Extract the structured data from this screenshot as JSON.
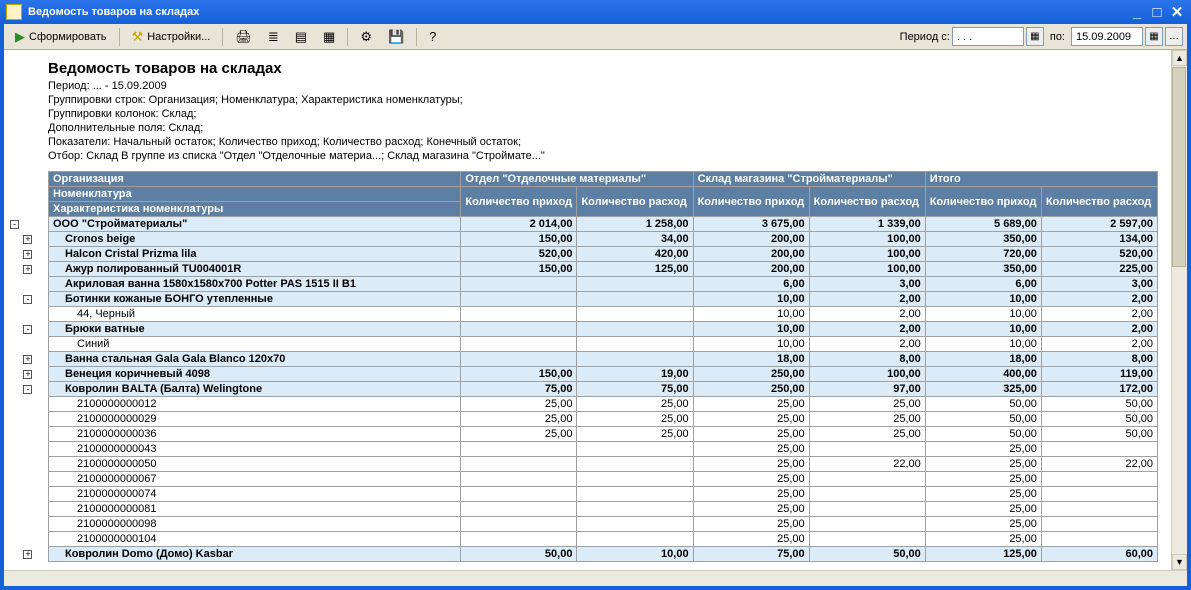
{
  "window": {
    "title": "Ведомость товаров на складах"
  },
  "toolbar": {
    "generate": "Сформировать",
    "settings": "Настройки...",
    "period_from_label": "Период с:",
    "period_from": ". . .",
    "period_to_label": "по:",
    "period_to": "15.09.2009"
  },
  "report": {
    "title": "Ведомость товаров на складах",
    "period": "Период: ... - 15.09.2009",
    "group_rows": "Группировки строк: Организация; Номенклатура; Характеристика номенклатуры;",
    "group_cols": "Группировки колонок: Склад;",
    "extra_fields": "Дополнительные поля: Склад;",
    "metrics": "Показатели: Начальный остаток; Количество приход; Количество расход; Конечный остаток;",
    "filter": "Отбор: Склад В группе из списка \"Отдел \"Отделочные материа...; Склад магазина \"Строймате...\""
  },
  "columns": {
    "org": "Организация",
    "nomen": "Номенклатура",
    "char": "Характеристика номенклатуры",
    "g1": "Отдел \"Отделочные материалы\"",
    "g2": "Склад магазина \"Стройматериалы\"",
    "g3": "Итого",
    "qty_in": "Количество приход",
    "qty_out": "Количество расход"
  },
  "rows": [
    {
      "l": 0,
      "pm": "-",
      "name": "ООО \"Стройматериалы\"",
      "v": [
        "2 014,00",
        "1 258,00",
        "3 675,00",
        "1 339,00",
        "5 689,00",
        "2 597,00"
      ]
    },
    {
      "l": 1,
      "pm": "+",
      "name": "Cronos beige",
      "v": [
        "150,00",
        "34,00",
        "200,00",
        "100,00",
        "350,00",
        "134,00"
      ]
    },
    {
      "l": 1,
      "pm": "+",
      "name": "Halcon Cristal Prizma lila",
      "v": [
        "520,00",
        "420,00",
        "200,00",
        "100,00",
        "720,00",
        "520,00"
      ]
    },
    {
      "l": 1,
      "pm": "+",
      "name": "Ажур полированный TU004001R",
      "v": [
        "150,00",
        "125,00",
        "200,00",
        "100,00",
        "350,00",
        "225,00"
      ]
    },
    {
      "l": 1,
      "pm": "",
      "name": "Акриловая ванна 1580x1580x700 Potter PAS 1515 II B1",
      "v": [
        "",
        "",
        "6,00",
        "3,00",
        "6,00",
        "3,00"
      ]
    },
    {
      "l": 1,
      "pm": "-",
      "name": "Ботинки кожаные БОНГО утепленные",
      "v": [
        "",
        "",
        "10,00",
        "2,00",
        "10,00",
        "2,00"
      ]
    },
    {
      "l": 2,
      "pm": "",
      "name": "44, Черный",
      "v": [
        "",
        "",
        "10,00",
        "2,00",
        "10,00",
        "2,00"
      ]
    },
    {
      "l": 1,
      "pm": "-",
      "name": "Брюки ватные",
      "v": [
        "",
        "",
        "10,00",
        "2,00",
        "10,00",
        "2,00"
      ]
    },
    {
      "l": 2,
      "pm": "",
      "name": "Синий",
      "v": [
        "",
        "",
        "10,00",
        "2,00",
        "10,00",
        "2,00"
      ]
    },
    {
      "l": 1,
      "pm": "+",
      "name": "Ванна стальная Gala Gala Blanco 120x70",
      "v": [
        "",
        "",
        "18,00",
        "8,00",
        "18,00",
        "8,00"
      ]
    },
    {
      "l": 1,
      "pm": "+",
      "name": "Венеция коричневый 4098",
      "v": [
        "150,00",
        "19,00",
        "250,00",
        "100,00",
        "400,00",
        "119,00"
      ]
    },
    {
      "l": 1,
      "pm": "-",
      "name": "Ковролин BALTA (Балта) Welingtone",
      "v": [
        "75,00",
        "75,00",
        "250,00",
        "97,00",
        "325,00",
        "172,00"
      ]
    },
    {
      "l": 2,
      "pm": "",
      "name": "2100000000012",
      "v": [
        "25,00",
        "25,00",
        "25,00",
        "25,00",
        "50,00",
        "50,00"
      ]
    },
    {
      "l": 2,
      "pm": "",
      "name": "2100000000029",
      "v": [
        "25,00",
        "25,00",
        "25,00",
        "25,00",
        "50,00",
        "50,00"
      ]
    },
    {
      "l": 2,
      "pm": "",
      "name": "2100000000036",
      "v": [
        "25,00",
        "25,00",
        "25,00",
        "25,00",
        "50,00",
        "50,00"
      ]
    },
    {
      "l": 2,
      "pm": "",
      "name": "2100000000043",
      "v": [
        "",
        "",
        "25,00",
        "",
        "25,00",
        ""
      ]
    },
    {
      "l": 2,
      "pm": "",
      "name": "2100000000050",
      "v": [
        "",
        "",
        "25,00",
        "22,00",
        "25,00",
        "22,00"
      ]
    },
    {
      "l": 2,
      "pm": "",
      "name": "2100000000067",
      "v": [
        "",
        "",
        "25,00",
        "",
        "25,00",
        ""
      ]
    },
    {
      "l": 2,
      "pm": "",
      "name": "2100000000074",
      "v": [
        "",
        "",
        "25,00",
        "",
        "25,00",
        ""
      ]
    },
    {
      "l": 2,
      "pm": "",
      "name": "2100000000081",
      "v": [
        "",
        "",
        "25,00",
        "",
        "25,00",
        ""
      ]
    },
    {
      "l": 2,
      "pm": "",
      "name": "2100000000098",
      "v": [
        "",
        "",
        "25,00",
        "",
        "25,00",
        ""
      ]
    },
    {
      "l": 2,
      "pm": "",
      "name": "2100000000104",
      "v": [
        "",
        "",
        "25,00",
        "",
        "25,00",
        ""
      ]
    },
    {
      "l": 1,
      "pm": "+",
      "name": "Ковролин Domo (Домо) Kasbar",
      "v": [
        "50,00",
        "10,00",
        "75,00",
        "50,00",
        "125,00",
        "60,00"
      ]
    }
  ]
}
